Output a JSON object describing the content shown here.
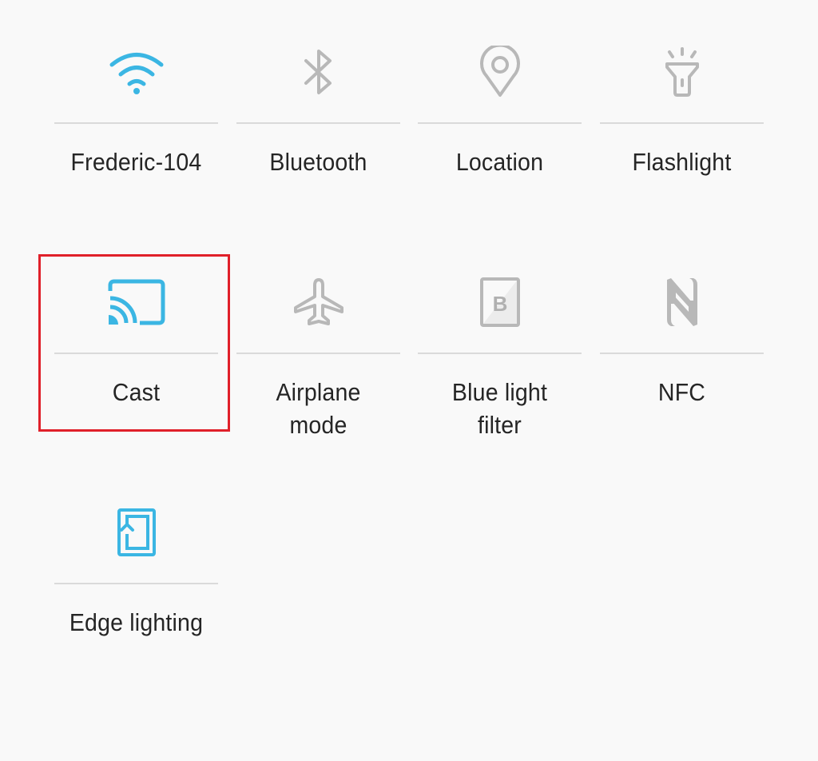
{
  "colors": {
    "active": "#3bb6e3",
    "inactive": "#b8b8b8",
    "label": "#252525",
    "divider": "#dadada",
    "highlight": "#e0202a",
    "background": "#f9f9f9"
  },
  "tiles": [
    {
      "id": "wifi",
      "label": "Frederic-104",
      "icon": "wifi-icon",
      "state": "on"
    },
    {
      "id": "bluetooth",
      "label": "Bluetooth",
      "icon": "bluetooth-icon",
      "state": "off"
    },
    {
      "id": "location",
      "label": "Location",
      "icon": "location-pin-icon",
      "state": "off"
    },
    {
      "id": "flashlight",
      "label": "Flashlight",
      "icon": "flashlight-icon",
      "state": "off"
    },
    {
      "id": "cast",
      "label": "Cast",
      "icon": "cast-icon",
      "state": "on",
      "highlighted": true
    },
    {
      "id": "airplane",
      "label": "Airplane\nmode",
      "icon": "airplane-icon",
      "state": "off"
    },
    {
      "id": "blue-light",
      "label": "Blue light\nfilter",
      "icon": "blue-light-filter-icon",
      "state": "off"
    },
    {
      "id": "nfc",
      "label": "NFC",
      "icon": "nfc-icon",
      "state": "off"
    },
    {
      "id": "edge-lighting",
      "label": "Edge lighting",
      "icon": "edge-lighting-icon",
      "state": "on"
    }
  ]
}
